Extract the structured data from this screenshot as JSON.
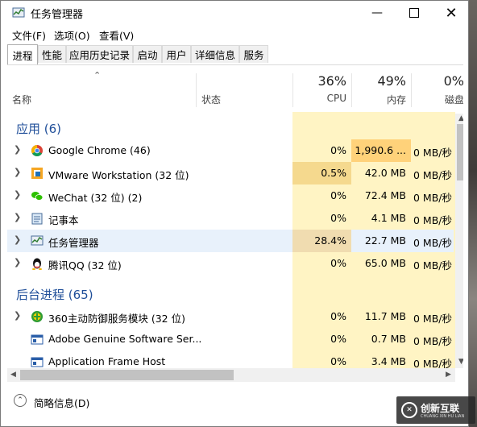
{
  "window": {
    "title": "任务管理器"
  },
  "menu": [
    "文件(F)",
    "选项(O)",
    "查看(V)"
  ],
  "tabs": [
    "进程",
    "性能",
    "应用历史记录",
    "启动",
    "用户",
    "详细信息",
    "服务"
  ],
  "header": {
    "name": "名称",
    "status": "状态",
    "cpu_pct": "36%",
    "cpu": "CPU",
    "mem_pct": "49%",
    "mem": "内存",
    "disk_pct": "0%",
    "disk": "磁盘"
  },
  "groups": {
    "apps": "应用 (6)",
    "background": "后台进程 (65)"
  },
  "rows": [
    {
      "name": "Google Chrome (46)",
      "cpu": "0%",
      "mem": "1,990.6 ...",
      "disk": "0 MB/秒"
    },
    {
      "name": "VMware Workstation (32 位)",
      "cpu": "0.5%",
      "mem": "42.0 MB",
      "disk": "0 MB/秒"
    },
    {
      "name": "WeChat (32 位) (2)",
      "cpu": "0%",
      "mem": "72.4 MB",
      "disk": "0 MB/秒"
    },
    {
      "name": "记事本",
      "cpu": "0%",
      "mem": "4.1 MB",
      "disk": "0 MB/秒"
    },
    {
      "name": "任务管理器",
      "cpu": "28.4%",
      "mem": "22.7 MB",
      "disk": "0 MB/秒"
    },
    {
      "name": "腾讯QQ (32 位)",
      "cpu": "0%",
      "mem": "65.0 MB",
      "disk": "0 MB/秒"
    },
    {
      "name": "360主动防御服务模块 (32 位)",
      "cpu": "0%",
      "mem": "11.7 MB",
      "disk": "0 MB/秒"
    },
    {
      "name": "Adobe Genuine Software Ser...",
      "cpu": "0%",
      "mem": "0.7 MB",
      "disk": "0 MB/秒"
    },
    {
      "name": "Application Frame Host",
      "cpu": "0%",
      "mem": "3.4 MB",
      "disk": "0 MB/秒"
    }
  ],
  "footer": {
    "fewer_details": "简略信息(D)"
  },
  "watermark": {
    "text": "创新互联",
    "sub": "CHUANG XIN HU LIAN"
  },
  "colors": {
    "cpu_bg": "#fff4c4",
    "mem_bg": "#ffd27a",
    "cpu_hi": "#f5d98e",
    "mem_hi": "#ffc55a",
    "group": "#1f4e99",
    "selected": "#e8f1fb"
  }
}
